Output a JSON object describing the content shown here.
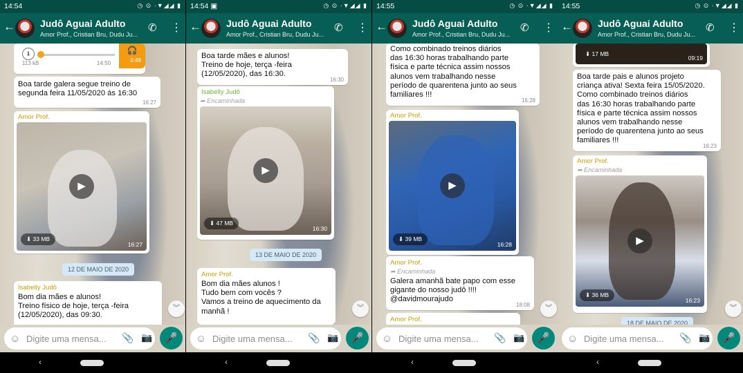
{
  "screens": [
    {
      "status": {
        "time": "14:54",
        "icons": "◷ ⊙ ·▼◢◢ ▮"
      },
      "header": {
        "title": "Judô Aguai Adulto",
        "subtitle": "Amor Prof., Cristian Bru, Dudu Ju..."
      },
      "audio": {
        "size": "113 kB",
        "time": "14:50",
        "duration": "0:49"
      },
      "msg1": {
        "text": "Boa tarde galera segue treino de\nsegunda feira 11/05/2020 ás 16:30",
        "time": "16:27"
      },
      "video": {
        "sender": "Amor Prof.",
        "size": "33 MB",
        "time": "16:27"
      },
      "date_label": "12 DE MAIO DE 2020",
      "msg2": {
        "sender": "Isabelly Judô",
        "text": "Bom dia mães e alunos!\nTreino físico de hoje, terça -feira\n(12/05/2020), das 09:30."
      },
      "input_placeholder": "Digite uma mensa..."
    },
    {
      "status": {
        "time": "14:54",
        "icons": "◷ ⊙ ·▼◢◢ ▮"
      },
      "header": {
        "title": "Judô Aguai Adulto",
        "subtitle": "Amor Prof., Cristian Bru, Dudu Ju..."
      },
      "msg1": {
        "text": "Boa tarde mães e alunos!\nTreino de hoje, terça -feira\n(12/05/2020), das 16:30.",
        "time": "16:30"
      },
      "video": {
        "sender": "Isabelly Judô",
        "forwarded": "Encaminhada",
        "size": "47 MB",
        "time": "16:30"
      },
      "date_label": "13 DE MAIO DE 2020",
      "msg2": {
        "sender": "Amor Prof.",
        "text": "Bom dia mães alunos !\nTudo bem com vocês ?\nVamos a treino de aquecimento da\nmanhã !"
      },
      "input_placeholder": "Digite uma mensa..."
    },
    {
      "status": {
        "time": "14:55",
        "icons": "◷ ⊙ ·▼◢◢ ▮"
      },
      "header": {
        "title": "Judô Aguai Adulto",
        "subtitle": "Amor Prof., Cristian Bru, Dudu Ju..."
      },
      "msg1": {
        "text": "Como combinado treinos diários\ndas 16:30 horas trabalhando parte\nfísica e parte técnica assim nossos\nalunos vem trabalhando nesse\nperíodo de quarentena junto ao seus\nfamiliares !!!",
        "time": "16:28"
      },
      "video": {
        "sender": "Amor Prof.",
        "size": "39 MB",
        "time": "16:28"
      },
      "msg2": {
        "sender": "Amor Prof.",
        "forwarded": "Encaminhada",
        "text": "Galera amanhã bate papo com esse\ngigante do nosso judô !!!!\n@davidmourajudo",
        "time": "18:08"
      },
      "msg3": {
        "sender": "Amor Prof."
      },
      "input_placeholder": "Digite uma mensa..."
    },
    {
      "status": {
        "time": "14:55",
        "icons": "◷ ⊙ ·▼◢◢ ▮"
      },
      "header": {
        "title": "Judô Aguai Adulto",
        "subtitle": "Amor Prof., Cristian Bru, Dudu Ju..."
      },
      "video_top": {
        "size": "17 MB",
        "time": "09:19"
      },
      "msg1": {
        "text": "Boa tarde pais e alunos projeto\ncriança ativa! Sexta feira 15/05/2020.\nComo combinado treinos diários\ndas 16:30 horas trabalhando parte\nfísica e parte técnica assim nossos\nalunos vem trabalhando nesse\nperíodo de quarentena junto ao seus\nfamiliares !!!",
        "time": "16:23"
      },
      "video": {
        "sender": "Amor Prof.",
        "forwarded": "Encaminhada",
        "size": "36 MB",
        "time": "16:23"
      },
      "date_label": "18 DE MAIO DE 2020",
      "input_placeholder": "Digite uma mensa..."
    }
  ],
  "icons": {
    "back": "←",
    "call": "📞",
    "more": "⋮",
    "play": "▶",
    "download": "⬇",
    "scroll_down": "︾",
    "emoji": "☺",
    "attach": "📎",
    "camera": "📷",
    "mic": "🎤",
    "headphones": "🎧",
    "nav_back": "‹",
    "forward": "➦"
  },
  "colors": {
    "header": "#075e54",
    "statusbar": "#054d44",
    "accent": "#00897b",
    "sender": "#c9a000",
    "date_pill": "#d4e9f5"
  }
}
